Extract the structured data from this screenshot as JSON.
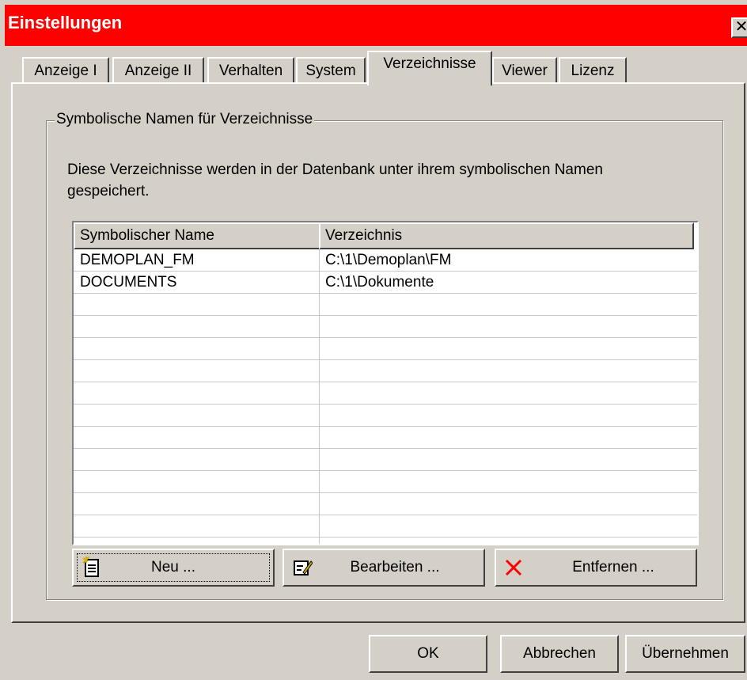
{
  "window": {
    "title": "Einstellungen",
    "close_glyph": "✕"
  },
  "tabs": [
    {
      "label": "Anzeige I"
    },
    {
      "label": "Anzeige II"
    },
    {
      "label": "Verhalten"
    },
    {
      "label": "System"
    },
    {
      "label": "Verzeichnisse",
      "active": true
    },
    {
      "label": "Viewer"
    },
    {
      "label": "Lizenz"
    }
  ],
  "group": {
    "title": "Symbolische Namen für Verzeichnisse",
    "description": "Diese Verzeichnisse werden in der Datenbank unter ihrem symbolischen Namen gespeichert."
  },
  "table": {
    "columns": [
      "Symbolischer Name",
      "Verzeichnis"
    ],
    "rows": [
      {
        "name": "DEMOPLAN_FM",
        "path": "C:\\1\\Demoplan\\FM"
      },
      {
        "name": "DOCUMENTS",
        "path": "C:\\1\\Dokumente"
      }
    ]
  },
  "actions": {
    "new_label": "Neu ...",
    "edit_label": "Bearbeiten ...",
    "remove_label": "Entfernen ...",
    "new_icon": "new-document-icon",
    "edit_icon": "edit-document-icon",
    "remove_icon": "delete-x-icon"
  },
  "dialog_buttons": {
    "ok_label": "OK",
    "cancel_label": "Abbrechen",
    "apply_label": "Übernehmen"
  },
  "colors": {
    "titlebar": "#ff0000",
    "remove_icon": "#ff0000",
    "face": "#d4d0c8"
  }
}
